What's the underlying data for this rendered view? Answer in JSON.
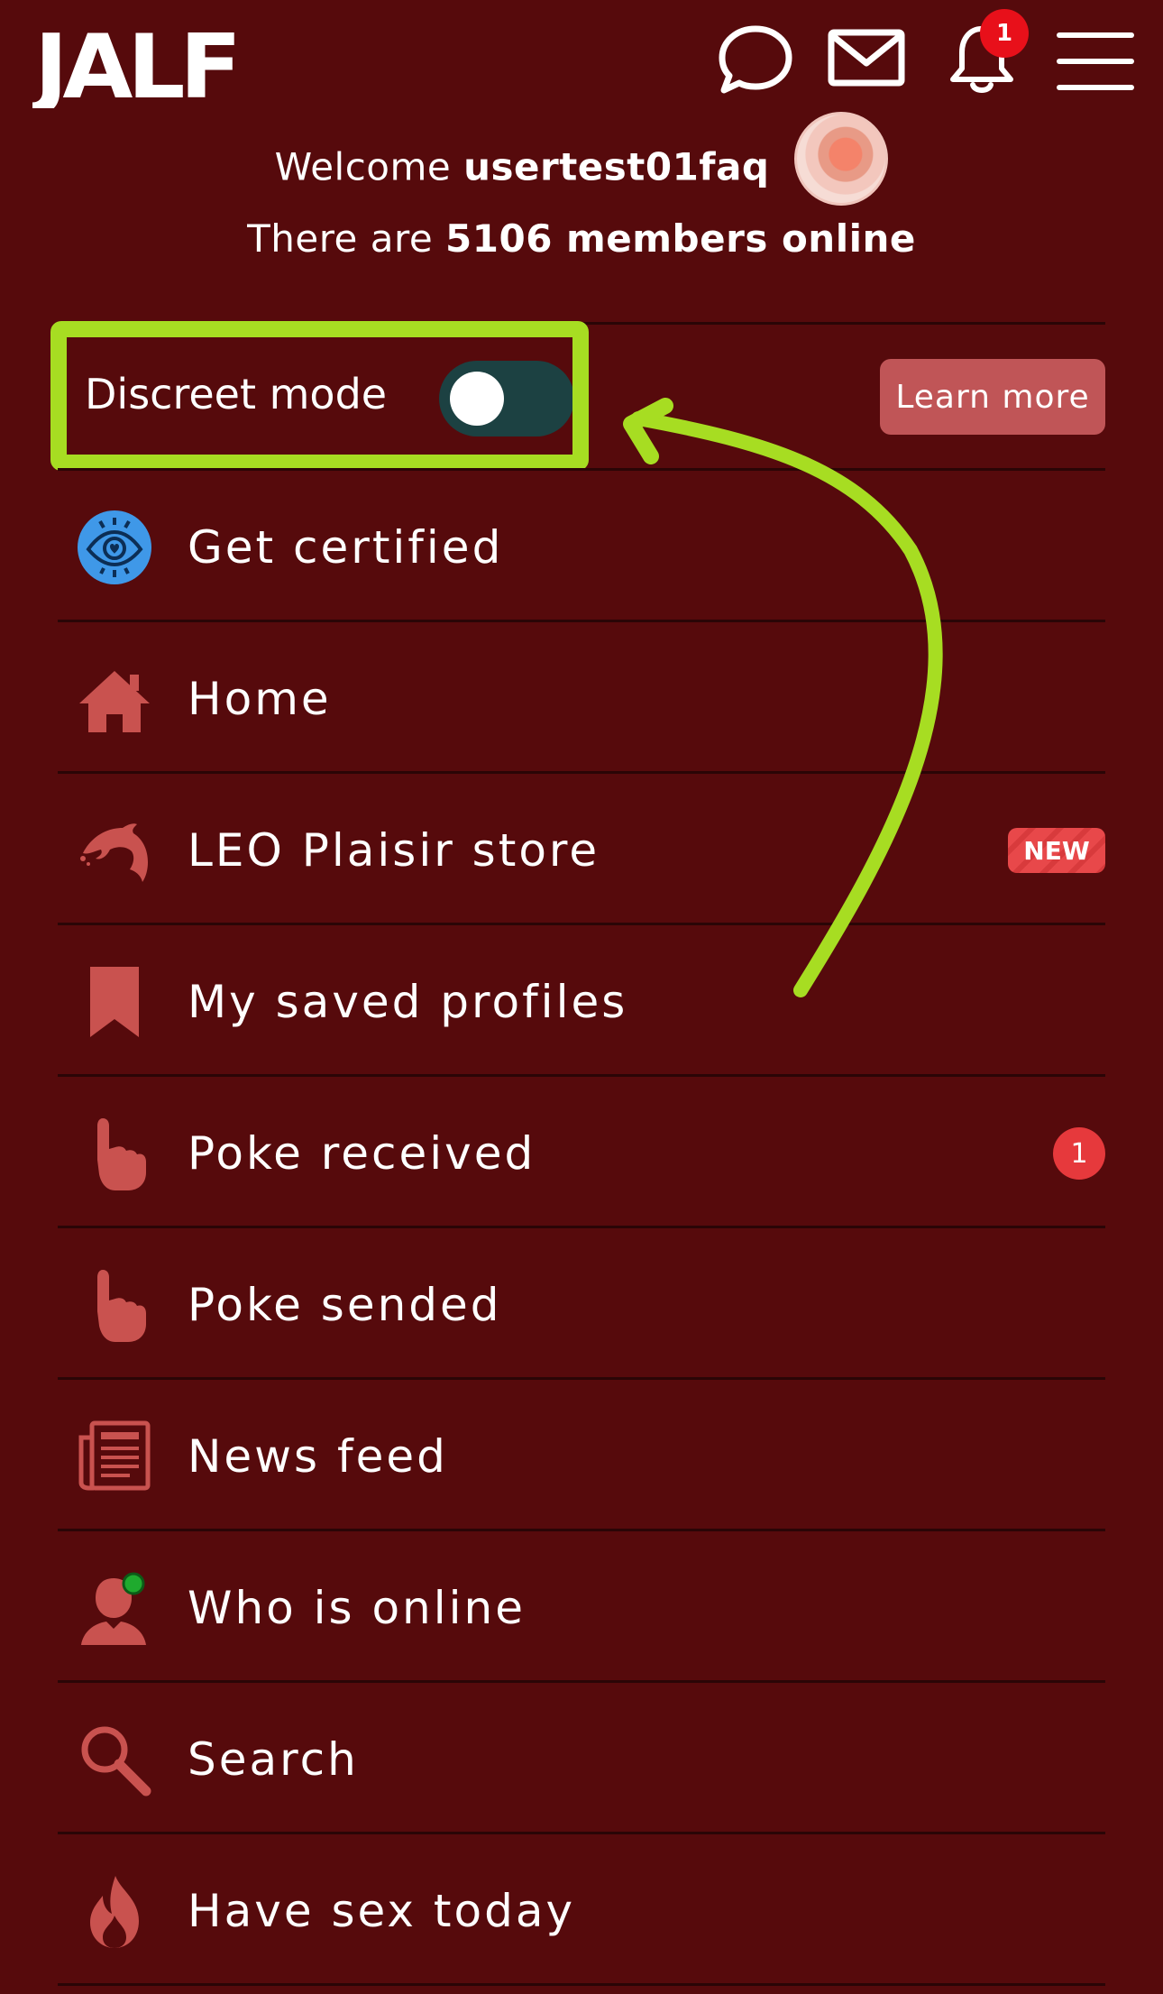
{
  "header": {
    "logo_text": "JALF",
    "notification_count": "1"
  },
  "welcome": {
    "prefix": "Welcome",
    "username": "usertest01faq",
    "online_prefix": "There are",
    "online_count_text": "5106 members online"
  },
  "discreet": {
    "label": "Discreet mode",
    "enabled": false,
    "learn_more": "Learn more"
  },
  "menu": {
    "items": [
      {
        "label": "Get certified",
        "icon": "certified-eye-icon"
      },
      {
        "label": "Home",
        "icon": "home-icon"
      },
      {
        "label": "LEO Plaisir store",
        "icon": "dolphin-icon",
        "badge": "NEW"
      },
      {
        "label": "My saved profiles",
        "icon": "bookmark-icon"
      },
      {
        "label": "Poke received",
        "icon": "pointing-hand-icon",
        "count": "1"
      },
      {
        "label": "Poke sended",
        "icon": "pointing-hand-icon"
      },
      {
        "label": "News feed",
        "icon": "newspaper-icon"
      },
      {
        "label": "Who is online",
        "icon": "online-user-icon"
      },
      {
        "label": "Search",
        "icon": "search-icon"
      },
      {
        "label": "Have sex today",
        "icon": "flame-icon"
      }
    ]
  },
  "colors": {
    "background": "#560a0c",
    "highlight": "#a7dd22",
    "icon": "#c9524f",
    "toggle_off": "#1c4142",
    "learn_more": "#c05557"
  }
}
